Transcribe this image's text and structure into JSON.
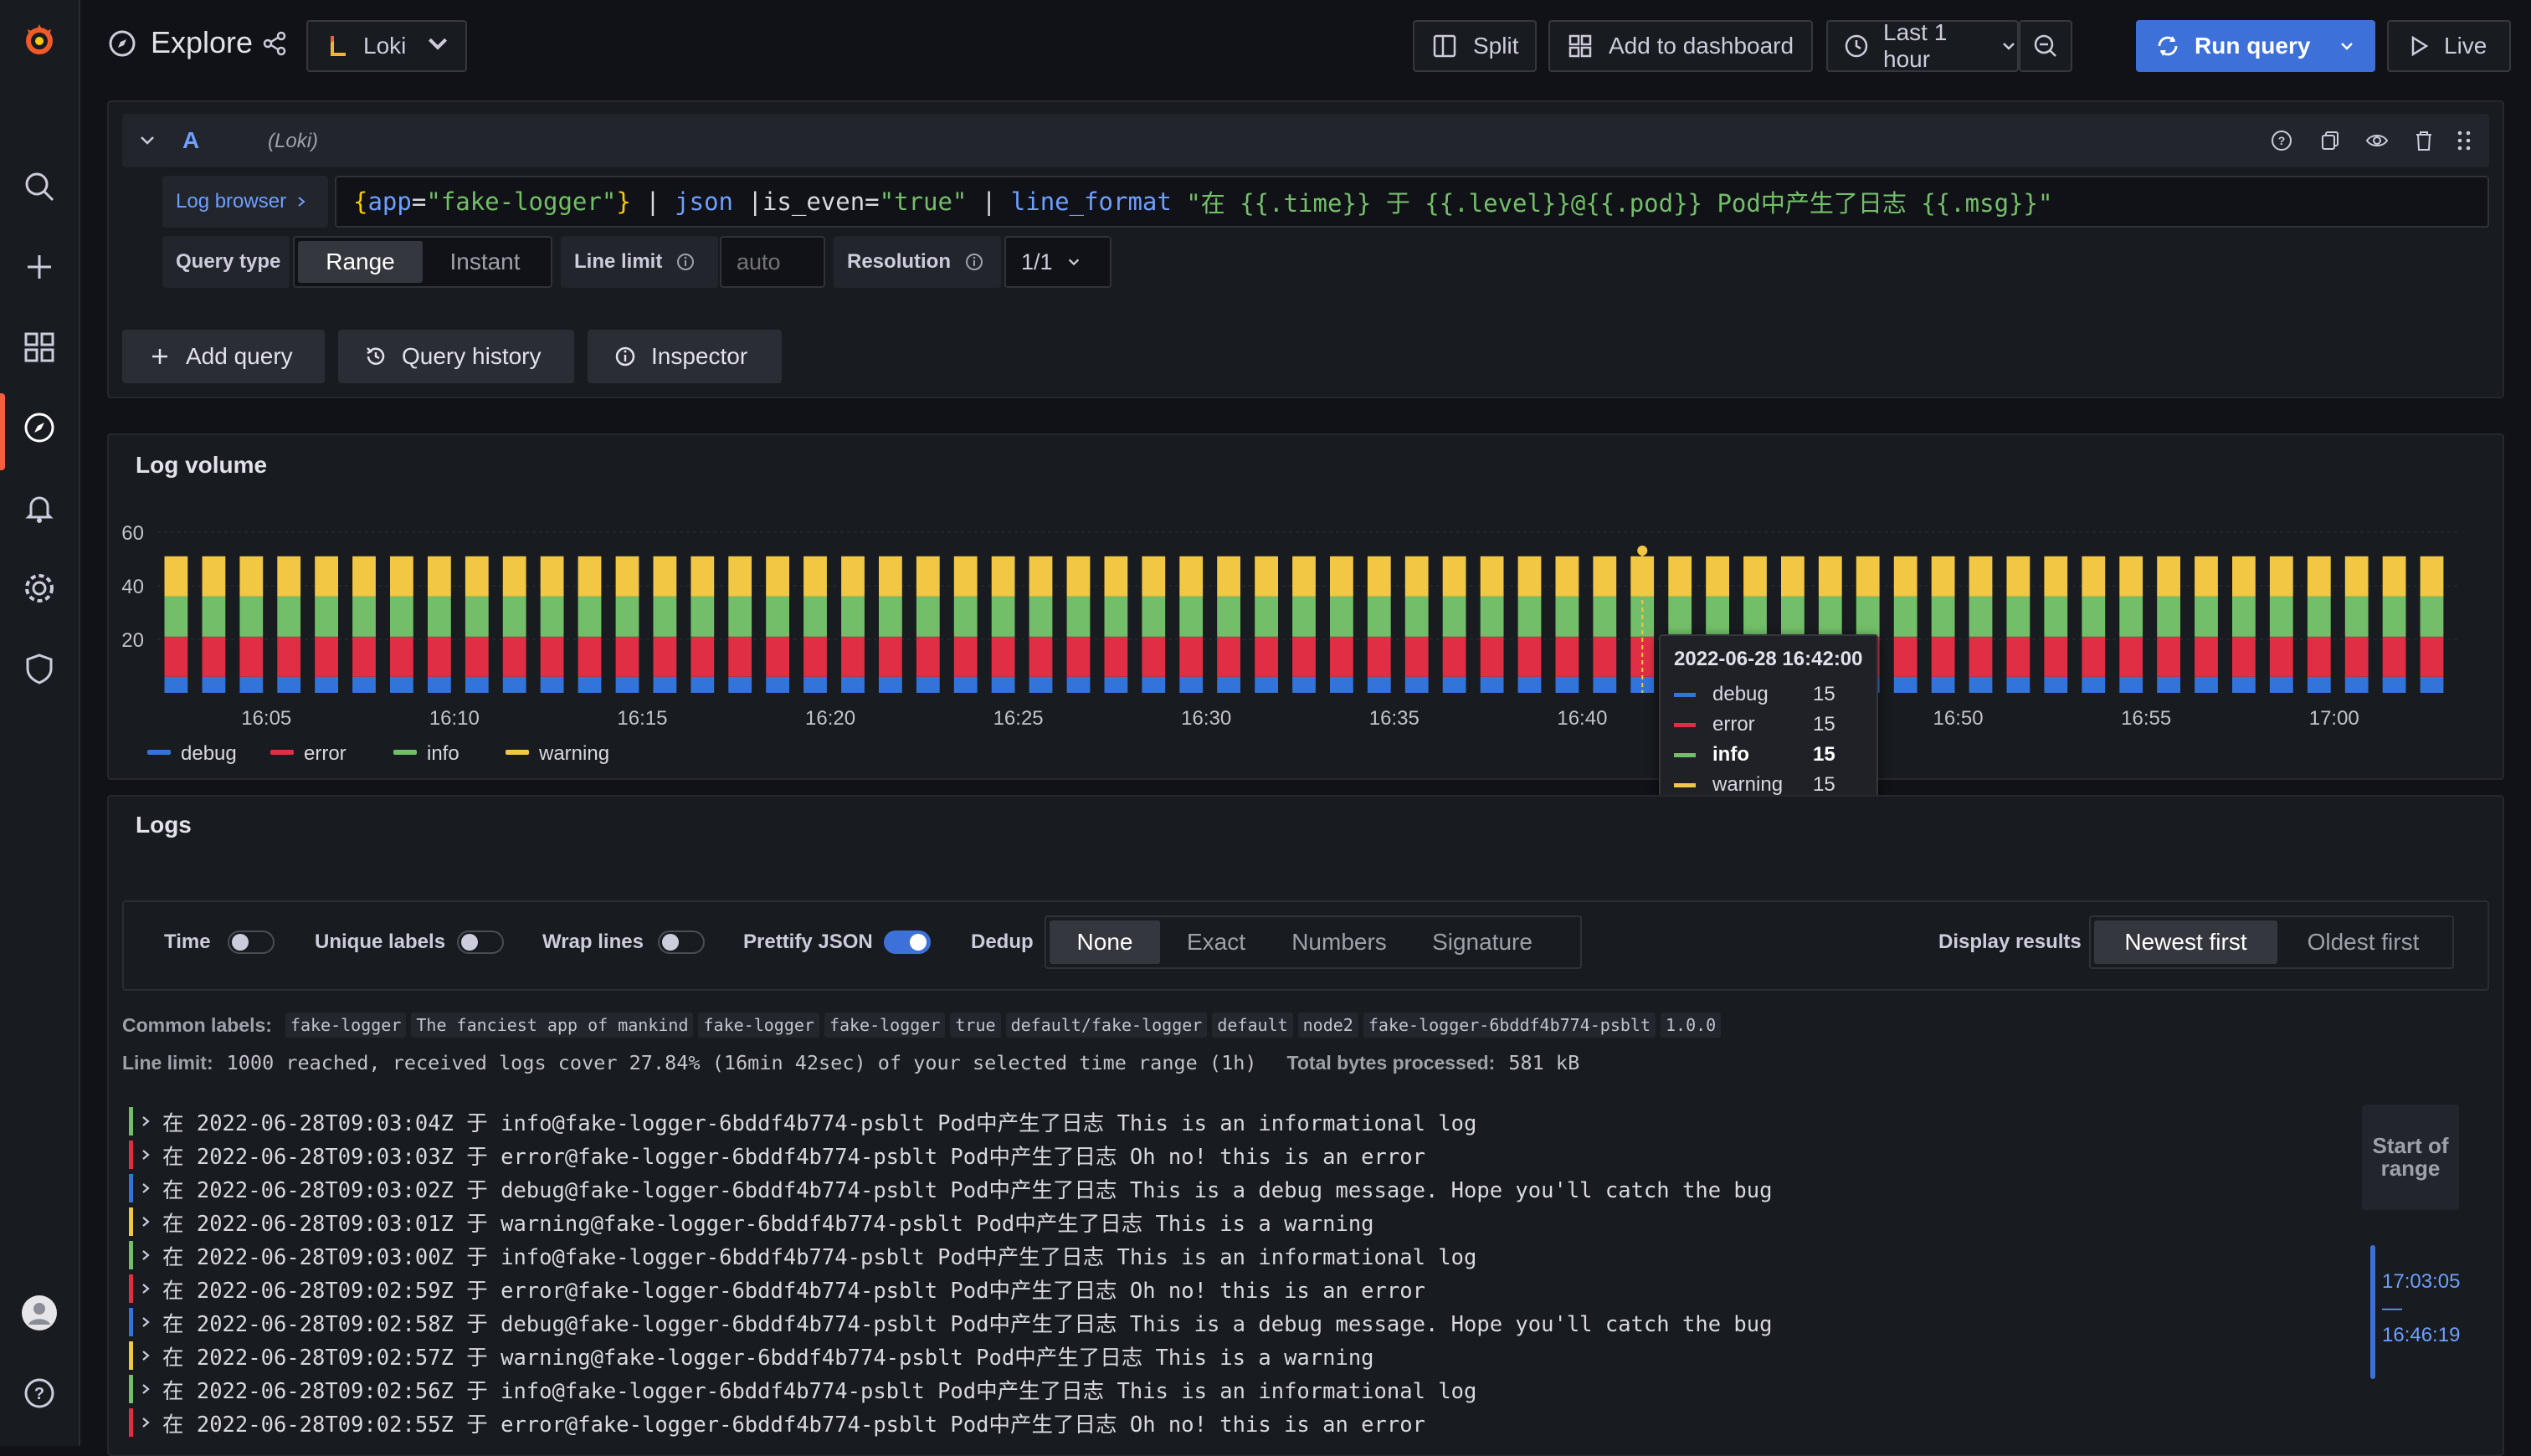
{
  "header": {
    "title": "Explore",
    "datasource": "Loki",
    "split_label": "Split",
    "add_dashboard_label": "Add to dashboard",
    "time_range": "Last 1 hour",
    "run_query_label": "Run query",
    "live_label": "Live"
  },
  "query": {
    "letter": "A",
    "datasource_hint": "(Loki)",
    "log_browser_label": "Log browser",
    "expr_parts": [
      {
        "text": "{",
        "color": "#f2cc0c"
      },
      {
        "text": "app",
        "color": "#6e9fff"
      },
      {
        "text": "=",
        "color": "#d8d9e0"
      },
      {
        "text": "\"fake-logger\"",
        "color": "#73bf69"
      },
      {
        "text": "}",
        "color": "#f2cc0c"
      },
      {
        "text": " | ",
        "color": "#d8d9e0"
      },
      {
        "text": "json",
        "color": "#6e9fff"
      },
      {
        "text": " |",
        "color": "#d8d9e0"
      },
      {
        "text": "is_even",
        "color": "#d8d9e0"
      },
      {
        "text": "=",
        "color": "#d8d9e0"
      },
      {
        "text": "\"true\"",
        "color": "#73bf69"
      },
      {
        "text": " | ",
        "color": "#d8d9e0"
      },
      {
        "text": "line_format",
        "color": "#6e9fff"
      },
      {
        "text": " \"在 {{.time}} 于 {{.level}}@{{.pod}} Pod中产生了日志 {{.msg}}\"",
        "color": "#73bf69"
      }
    ],
    "query_type_label": "Query type",
    "query_type_options": [
      "Range",
      "Instant"
    ],
    "line_limit_label": "Line limit",
    "line_limit_placeholder": "auto",
    "resolution_label": "Resolution",
    "resolution_value": "1/1",
    "add_query_label": "Add query",
    "query_history_label": "Query history",
    "inspector_label": "Inspector"
  },
  "log_volume": {
    "title": "Log volume",
    "tooltip": {
      "time": "2022-06-28 16:42:00",
      "rows": [
        {
          "name": "debug",
          "value": "15"
        },
        {
          "name": "error",
          "value": "15"
        },
        {
          "name": "info",
          "value": "15"
        },
        {
          "name": "warning",
          "value": "15"
        }
      ]
    }
  },
  "chart_data": {
    "type": "bar",
    "stacked": true,
    "title": "Log volume",
    "bar_count": 61,
    "x_ticks": [
      "16:05",
      "16:10",
      "16:15",
      "16:20",
      "16:25",
      "16:30",
      "16:35",
      "16:40",
      "16:45",
      "16:50",
      "16:55",
      "17:00"
    ],
    "y_ticks": [
      20,
      40,
      60
    ],
    "ylim": [
      0,
      68
    ],
    "series": [
      {
        "name": "debug",
        "color": "#3274d9",
        "value": 6
      },
      {
        "name": "error",
        "color": "#e02f44",
        "value": 15
      },
      {
        "name": "info",
        "color": "#73bf69",
        "value": 15
      },
      {
        "name": "warning",
        "color": "#f2c744",
        "value": 15
      }
    ],
    "highlight_index": 39,
    "legend_position": "bottom-left",
    "grid": true
  },
  "logs": {
    "title": "Logs",
    "options": {
      "time": "Time",
      "unique_labels": "Unique labels",
      "wrap_lines": "Wrap lines",
      "prettify_json": "Prettify JSON",
      "dedup": "Dedup",
      "dedup_options": [
        "None",
        "Exact",
        "Numbers",
        "Signature"
      ],
      "display_results": "Display results",
      "order_options": [
        "Newest first",
        "Oldest first"
      ]
    },
    "common_labels_title": "Common labels:",
    "common_labels": [
      "fake-logger",
      "The fanciest app of mankind",
      "fake-logger",
      "fake-logger",
      "true",
      "default/fake-logger",
      "default",
      "node2",
      "fake-logger-6bddf4b774-psblt",
      "1.0.0"
    ],
    "line_limit_title": "Line limit:",
    "line_limit_text": "1000 reached, received logs cover 27.84% (16min 42sec) of your selected time range (1h)",
    "bytes_title": "Total bytes processed:",
    "bytes_value": "581 kB",
    "rows": [
      {
        "level": "info",
        "color": "#73bf69",
        "text": "在 2022-06-28T09:03:04Z 于 info@fake-logger-6bddf4b774-psblt Pod中产生了日志 This is an informational log"
      },
      {
        "level": "error",
        "color": "#e02f44",
        "text": "在 2022-06-28T09:03:03Z 于 error@fake-logger-6bddf4b774-psblt Pod中产生了日志 Oh no! this is an error"
      },
      {
        "level": "debug",
        "color": "#3274d9",
        "text": "在 2022-06-28T09:03:02Z 于 debug@fake-logger-6bddf4b774-psblt Pod中产生了日志 This is a debug message. Hope you'll catch the bug"
      },
      {
        "level": "warning",
        "color": "#f2c744",
        "text": "在 2022-06-28T09:03:01Z 于 warning@fake-logger-6bddf4b774-psblt Pod中产生了日志 This is a warning"
      },
      {
        "level": "info",
        "color": "#73bf69",
        "text": "在 2022-06-28T09:03:00Z 于 info@fake-logger-6bddf4b774-psblt Pod中产生了日志 This is an informational log"
      },
      {
        "level": "error",
        "color": "#e02f44",
        "text": "在 2022-06-28T09:02:59Z 于 error@fake-logger-6bddf4b774-psblt Pod中产生了日志 Oh no! this is an error"
      },
      {
        "level": "debug",
        "color": "#3274d9",
        "text": "在 2022-06-28T09:02:58Z 于 debug@fake-logger-6bddf4b774-psblt Pod中产生了日志 This is a debug message. Hope you'll catch the bug"
      },
      {
        "level": "warning",
        "color": "#f2c744",
        "text": "在 2022-06-28T09:02:57Z 于 warning@fake-logger-6bddf4b774-psblt Pod中产生了日志 This is a warning"
      },
      {
        "level": "info",
        "color": "#73bf69",
        "text": "在 2022-06-28T09:02:56Z 于 info@fake-logger-6bddf4b774-psblt Pod中产生了日志 This is an informational log"
      },
      {
        "level": "error",
        "color": "#e02f44",
        "text": "在 2022-06-28T09:02:55Z 于 error@fake-logger-6bddf4b774-psblt Pod中产生了日志 Oh no! this is an error"
      }
    ],
    "navigation": {
      "start_label": "Start of range",
      "range_top": "17:03:05",
      "range_sep": "—",
      "range_bottom": "16:46:19"
    }
  }
}
